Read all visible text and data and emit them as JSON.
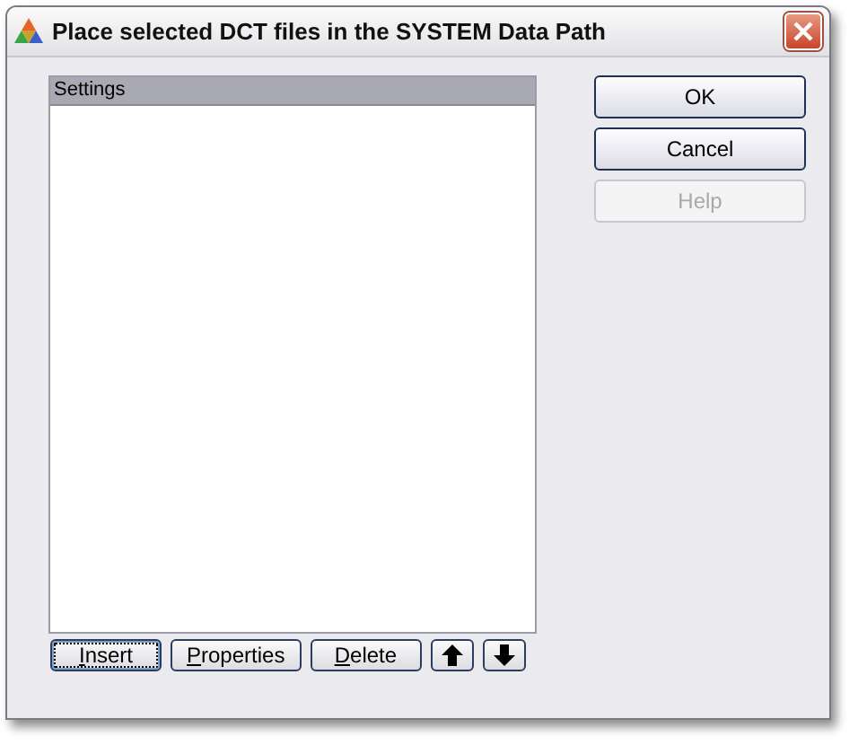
{
  "window": {
    "title": "Place selected DCT files in the SYSTEM Data Path"
  },
  "list": {
    "header": "Settings"
  },
  "list_buttons": [
    {
      "kind": "text",
      "label": "Insert",
      "underline_first": true,
      "focused": true
    },
    {
      "kind": "text",
      "label": "Properties",
      "underline_first": true,
      "focused": false
    },
    {
      "kind": "text",
      "label": "Delete",
      "underline_first": true,
      "focused": false
    },
    {
      "kind": "up",
      "focused": false
    },
    {
      "kind": "down",
      "focused": false
    }
  ],
  "buttons": [
    {
      "label": "OK",
      "disabled": false
    },
    {
      "label": "Cancel",
      "disabled": false
    },
    {
      "label": "Help",
      "disabled": true
    }
  ]
}
